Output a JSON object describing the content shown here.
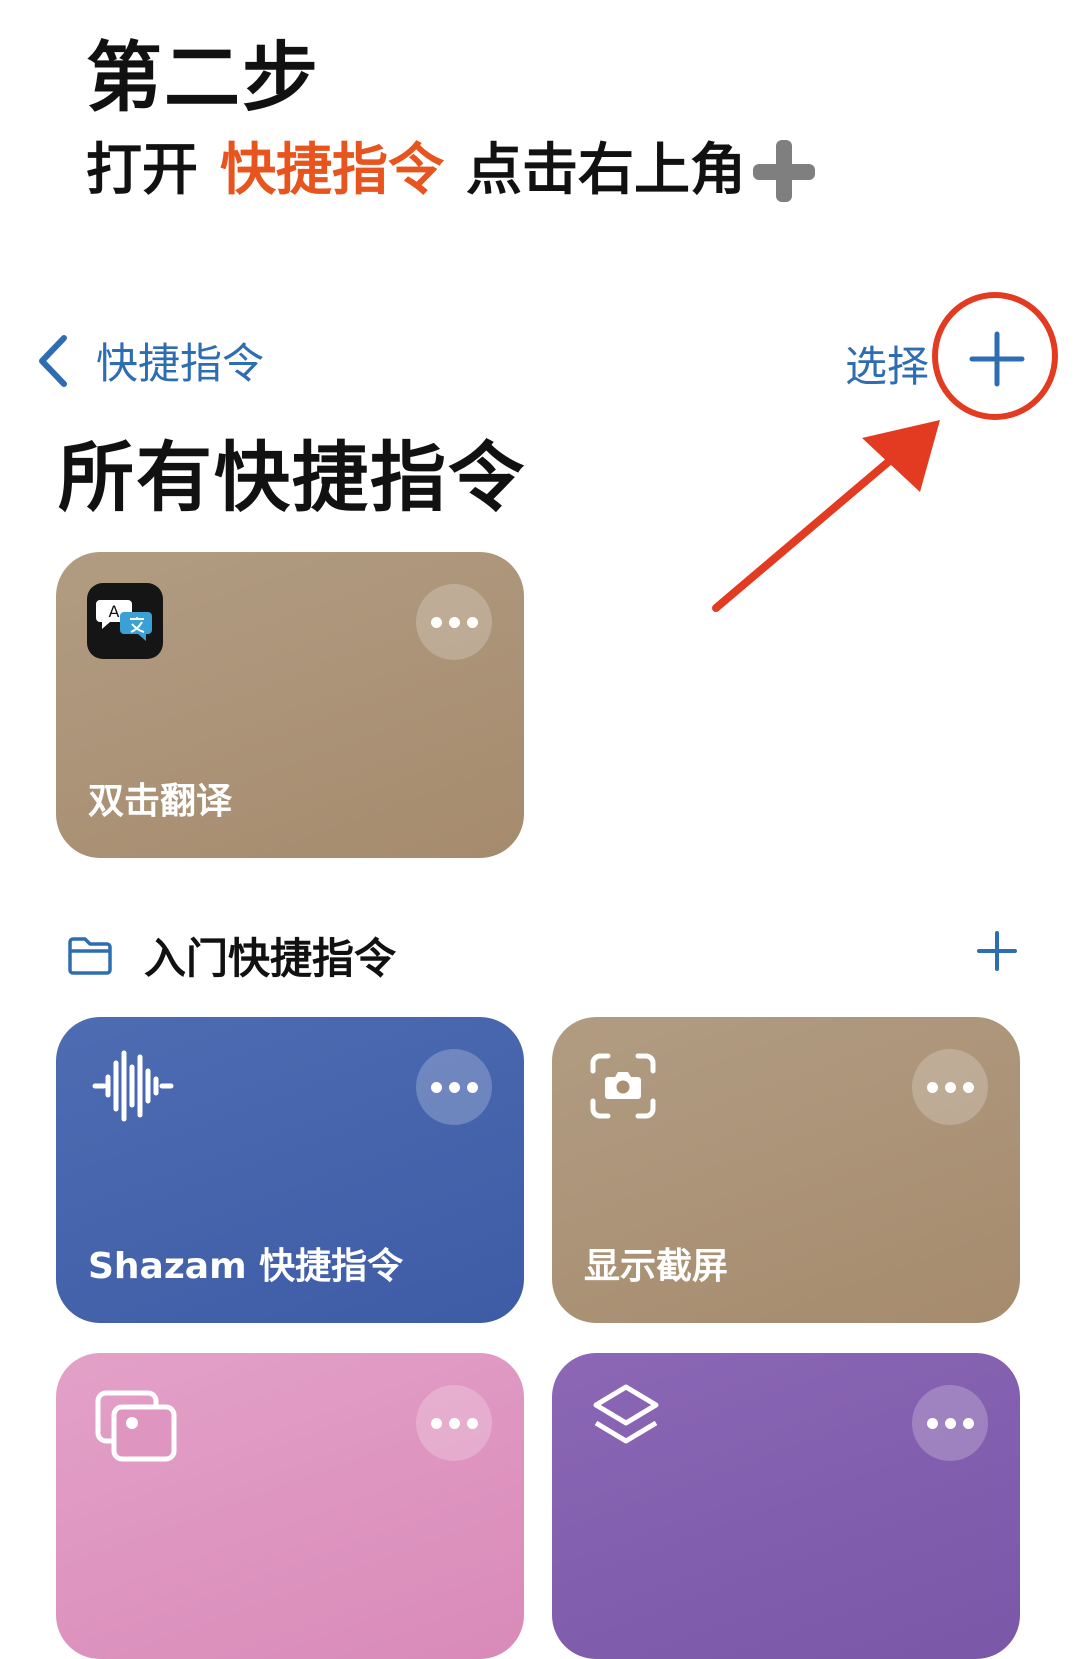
{
  "instruction": {
    "title": "第二步",
    "prefix": "打开",
    "app_name": "快捷指令",
    "suffix": "点击右上角",
    "plus_emoji": "plus-emoji-icon"
  },
  "nav": {
    "back_label": "快捷指令",
    "select_label": "选择"
  },
  "page_title": "所有快捷指令",
  "cards": [
    {
      "label": "双击翻译",
      "icon": "translate-icon",
      "color": "#aa8f71"
    },
    {
      "label": "Shazam 快捷指令",
      "icon": "waveform-icon",
      "color": "#4663ac"
    },
    {
      "label": "显示截屏",
      "icon": "screenshot-camera-icon",
      "color": "#aa8f71"
    },
    {
      "label": "",
      "icon": "photos-icon",
      "color": "#de95c0"
    },
    {
      "label": "",
      "icon": "layers-icon",
      "color": "#8460b0"
    }
  ],
  "section": {
    "label": "入门快捷指令"
  },
  "colors": {
    "accent_blue": "#2f6db3",
    "highlight_orange": "#e8541d",
    "annotation_red": "#e23b22"
  }
}
